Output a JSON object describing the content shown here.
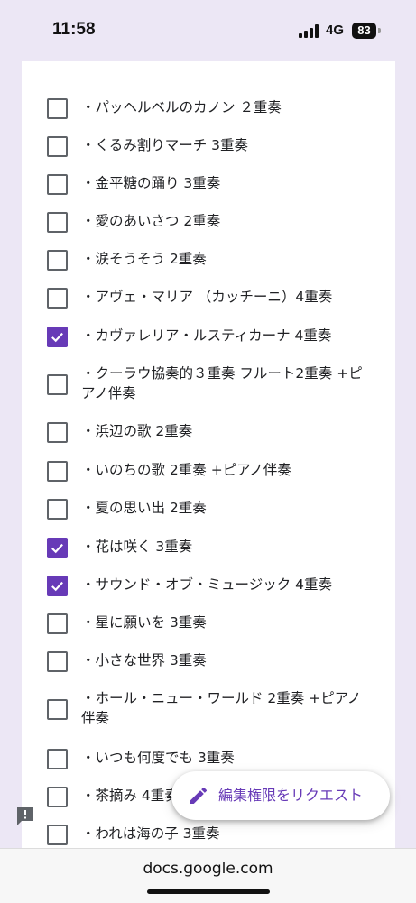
{
  "status_bar": {
    "time": "11:58",
    "network": "4G",
    "battery": "83"
  },
  "options": [
    {
      "label": "・パッヘルベルのカノン ２重奏",
      "checked": false
    },
    {
      "label": "・くるみ割りマーチ 3重奏",
      "checked": false
    },
    {
      "label": "・金平糖の踊り 3重奏",
      "checked": false
    },
    {
      "label": "・愛のあいさつ 2重奏",
      "checked": false
    },
    {
      "label": "・涙そうそう 2重奏",
      "checked": false
    },
    {
      "label": "・アヴェ・マリア （カッチーニ）4重奏",
      "checked": false
    },
    {
      "label": "・カヴァレリア・ルスティカーナ 4重奏",
      "checked": true
    },
    {
      "label": "・クーラウ協奏的３重奏 フルート2重奏 +ピアノ伴奏",
      "checked": false
    },
    {
      "label": "・浜辺の歌 2重奏",
      "checked": false
    },
    {
      "label": "・いのちの歌 2重奏 +ピアノ伴奏",
      "checked": false
    },
    {
      "label": "・夏の思い出 2重奏",
      "checked": false
    },
    {
      "label": "・花は咲く 3重奏",
      "checked": true
    },
    {
      "label": "・サウンド・オブ・ミュージック 4重奏",
      "checked": true
    },
    {
      "label": "・星に願いを 3重奏",
      "checked": false
    },
    {
      "label": "・小さな世界 3重奏",
      "checked": false
    },
    {
      "label": "・ホール・ニュー・ワールド 2重奏 +ピアノ伴奏",
      "checked": false
    },
    {
      "label": "・いつも何度でも 3重奏",
      "checked": false
    },
    {
      "label": "・茶摘み 4重奏",
      "checked": false
    },
    {
      "label": "・われは海の子 3重奏",
      "checked": false
    }
  ],
  "fab": {
    "label": "編集権限をリクエスト",
    "icon": "pencil-icon"
  },
  "report_icon": "report-icon",
  "browser": {
    "url": "docs.google.com"
  },
  "colors": {
    "accent": "#673ab7",
    "background": "#ece7f5",
    "unchecked_border": "#5f6368"
  }
}
